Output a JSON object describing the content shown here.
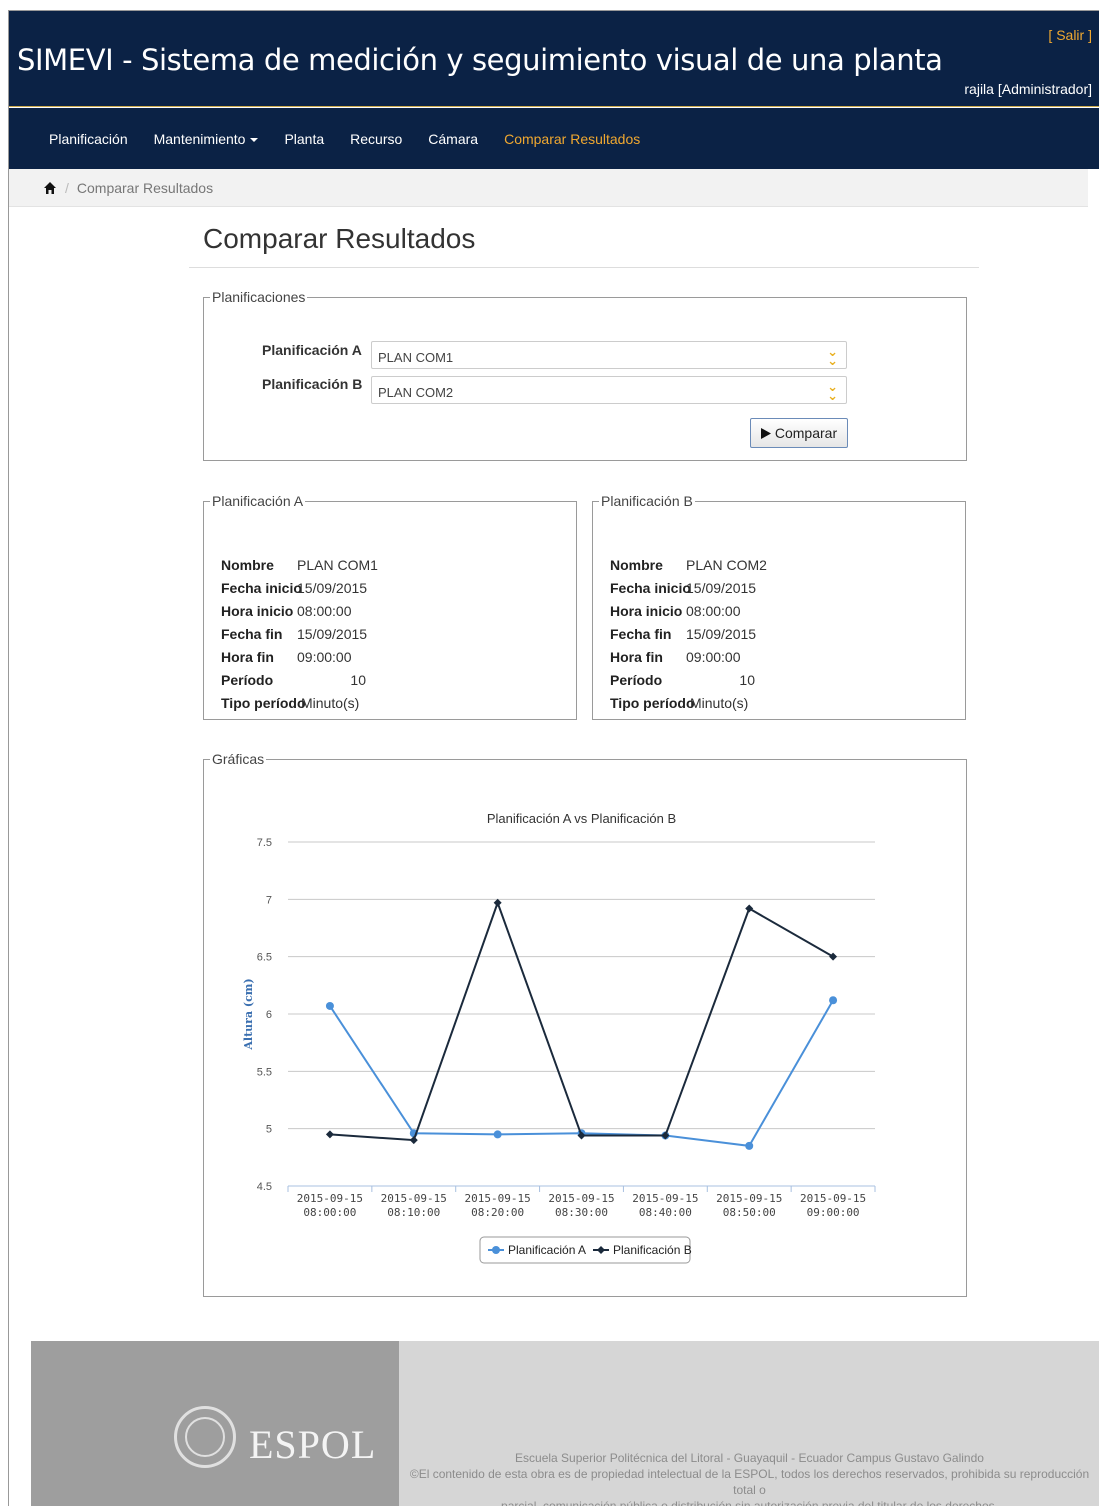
{
  "header": {
    "app_title": "SIMEVI - Sistema de medición y seguimiento visual de una planta",
    "logout_label": "[ Salir ]",
    "user_label": "rajila [Administrador]"
  },
  "nav": {
    "items": [
      {
        "label": "Planificación"
      },
      {
        "label": "Mantenimiento"
      },
      {
        "label": "Planta"
      },
      {
        "label": "Recurso"
      },
      {
        "label": "Cámara"
      },
      {
        "label": "Comparar Resultados"
      }
    ]
  },
  "breadcrumb": {
    "home_icon": "home-icon",
    "current": "Comparar Resultados"
  },
  "page": {
    "title": "Comparar Resultados"
  },
  "planificaciones": {
    "legend": "Planificaciones",
    "label_a": "Planificación A",
    "value_a": "PLAN COM1",
    "label_b": "Planificación B",
    "value_b": "PLAN COM2",
    "compare_label": "Comparar"
  },
  "details": {
    "keys": {
      "nombre": "Nombre",
      "fecha_inicio": "Fecha inicio",
      "hora_inicio": "Hora inicio",
      "fecha_fin": "Fecha fin",
      "hora_fin": "Hora fin",
      "periodo": "Período",
      "tipo_periodo": "Tipo período"
    },
    "a": {
      "legend": "Planificación A",
      "nombre": "PLAN COM1",
      "fecha_inicio": "15/09/2015",
      "hora_inicio": "08:00:00",
      "fecha_fin": "15/09/2015",
      "hora_fin": "09:00:00",
      "periodo": "10",
      "tipo_periodo": "Minuto(s)"
    },
    "b": {
      "legend": "Planificación B",
      "nombre": "PLAN COM2",
      "fecha_inicio": "15/09/2015",
      "hora_inicio": "08:00:00",
      "fecha_fin": "15/09/2015",
      "hora_fin": "09:00:00",
      "periodo": "10",
      "tipo_periodo": "Minuto(s)"
    }
  },
  "graficas": {
    "legend": "Gráficas"
  },
  "chart_data": {
    "type": "line",
    "title": "Planificación A vs Planificación B",
    "xlabel": "",
    "ylabel": "Altura (cm)",
    "categories": [
      [
        "2015-09-15",
        "08:00:00"
      ],
      [
        "2015-09-15",
        "08:10:00"
      ],
      [
        "2015-09-15",
        "08:20:00"
      ],
      [
        "2015-09-15",
        "08:30:00"
      ],
      [
        "2015-09-15",
        "08:40:00"
      ],
      [
        "2015-09-15",
        "08:50:00"
      ],
      [
        "2015-09-15",
        "09:00:00"
      ]
    ],
    "y_ticks": [
      "4.5",
      "5",
      "5.5",
      "6",
      "6.5",
      "7",
      "7.5"
    ],
    "ylim": [
      4.5,
      7.5
    ],
    "grid": true,
    "legend_position": "bottom-center",
    "series": [
      {
        "name": "Planificación A",
        "color": "#4a90d9",
        "marker": "circle",
        "values": [
          6.07,
          4.96,
          4.95,
          4.96,
          4.94,
          4.85,
          6.12
        ]
      },
      {
        "name": "Planificación B",
        "color": "#1b2a3c",
        "marker": "diamond",
        "values": [
          4.95,
          4.9,
          6.97,
          4.94,
          4.94,
          6.92,
          6.5
        ]
      }
    ]
  },
  "footer": {
    "logo_text": "ESPOL",
    "seal_icon": "espol-seal-icon",
    "line1": "Escuela Superior Politécnica del Litoral - Guayaquil - Ecuador Campus Gustavo Galindo",
    "line2": "©El contenido de esta obra es de propiedad intelectual de la ESPOL, todos los derechos reservados, prohibida su reproducción total o",
    "line3": "parcial, comunicación pública o distribución sin autorización previa del titular de los derechos."
  }
}
